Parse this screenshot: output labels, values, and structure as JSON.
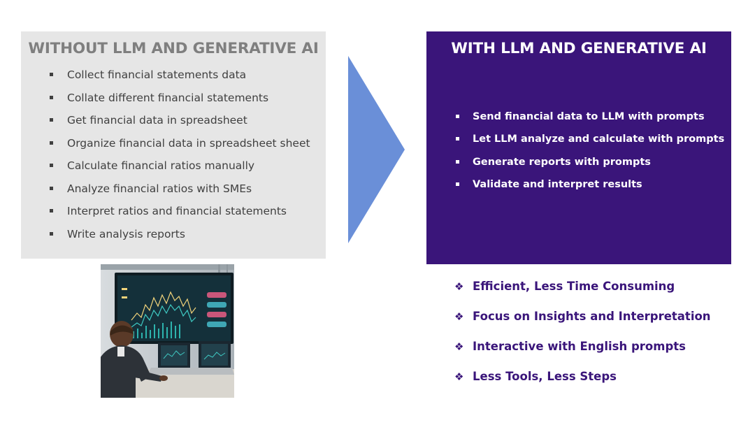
{
  "without": {
    "title": "WITHOUT LLM AND GENERATIVE AI",
    "items": [
      "Collect financial statements data",
      "Collate different financial statements",
      "Get financial data in spreadsheet",
      "Organize financial data in spreadsheet sheet",
      "Calculate financial ratios manually",
      "Analyze financial ratios with SMEs",
      "Interpret ratios and financial statements",
      "Write analysis reports"
    ]
  },
  "with": {
    "title": "WITH LLM AND GENERATIVE AI",
    "items": [
      "Send financial data to LLM with prompts",
      "Let LLM analyze and calculate with prompts",
      "Generate reports with prompts",
      "Validate and interpret results"
    ]
  },
  "benefits": [
    "Efficient, Less Time Consuming",
    "Focus on Insights and Interpretation",
    "Interactive with English prompts",
    "Less Tools, Less Steps"
  ],
  "colors": {
    "left_panel_bg": "#e6e6e6",
    "left_title": "#7f7f7f",
    "right_panel_bg": "#3a157a",
    "arrow": "#6a8fd8",
    "benefit_text": "#3a157a"
  },
  "icons": {
    "bullet": "square-bullet-icon",
    "benefit": "diamond-bullet-icon",
    "arrow": "right-arrow-icon",
    "photo": "person-at-trading-screens-photo"
  }
}
